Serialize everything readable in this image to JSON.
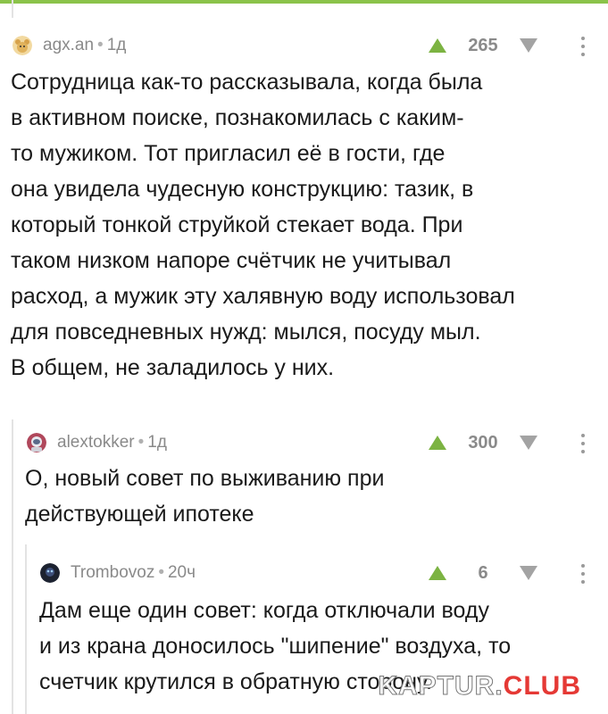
{
  "comments": [
    {
      "author": "agx.an",
      "time": "1д",
      "score": "265",
      "avatar_icon": "bear-avatar-icon",
      "lines": [
        "Сотрудница как-то рассказывала, когда была",
        "в активном поиске, познакомилась с каким-",
        "то мужиком. Тот пригласил её в гости, где",
        "она увидела чудесную конструкцию: тазик, в",
        "который тонкой струйкой стекает вода. При",
        "таком низком напоре счётчик не учитывал",
        "расход, а мужик эту халявную воду использовал",
        "для повседневных нужд: мылся, посуду мыл.",
        "В общем, не заладилось у них."
      ]
    },
    {
      "author": "alextokker",
      "time": "1д",
      "score": "300",
      "avatar_icon": "astronaut-avatar-icon",
      "lines": [
        "О, новый совет по выживанию при",
        "действующей ипотеке"
      ]
    },
    {
      "author": "Trombovoz",
      "time": "20ч",
      "score": "6",
      "avatar_icon": "dark-avatar-icon",
      "lines": [
        "Дам еще один совет: когда отключали воду",
        "и из крана доносилось \"шипение\" воздуха, то",
        "счетчик крутился в обратную сторону."
      ]
    }
  ],
  "watermark": {
    "part1": "KAPTUR.",
    "part2": "CLUB"
  },
  "colors": {
    "upvote": "#7cb342",
    "downvote": "#a3a3a3",
    "meta": "#8a8a8a",
    "thread": "#e3e3e3"
  }
}
